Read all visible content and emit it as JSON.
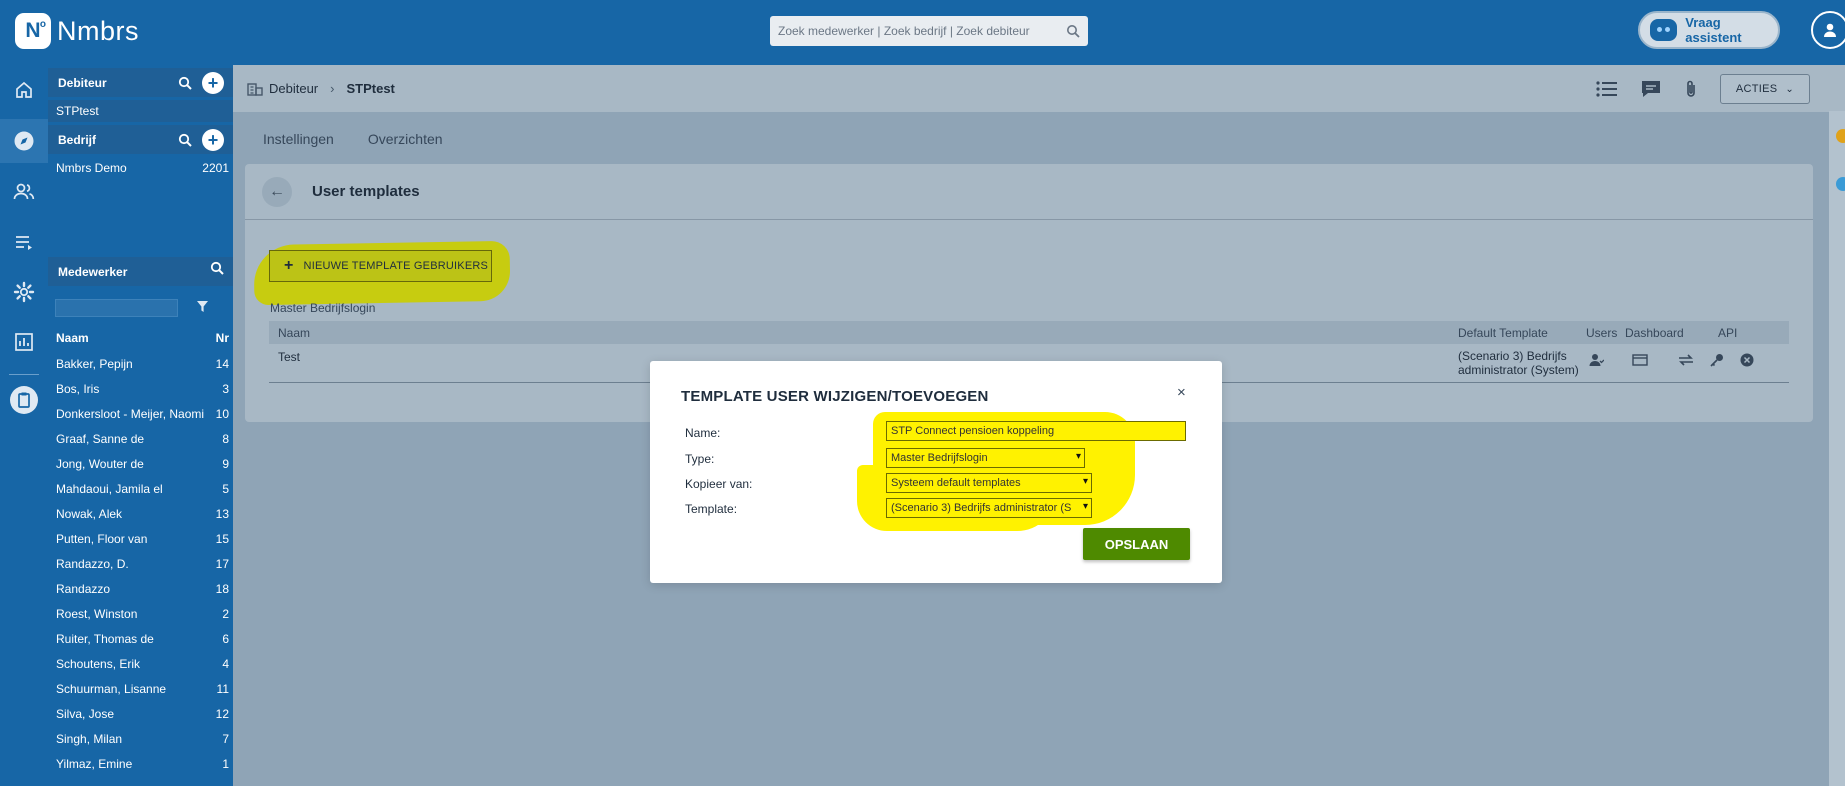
{
  "brand": {
    "name": "Nmbrs"
  },
  "top": {
    "search_placeholder": "Zoek medewerker | Zoek bedrijf | Zoek debiteur",
    "assistant_label": "Vraag assistent"
  },
  "sidebar": {
    "debiteur": {
      "header": "Debiteur",
      "items": [
        {
          "label": "STPtest"
        }
      ]
    },
    "bedrijf": {
      "header": "Bedrijf",
      "items": [
        {
          "label": "Nmbrs Demo",
          "num": "2201"
        }
      ]
    },
    "medewerker": {
      "header": "Medewerker",
      "columns": {
        "name": "Naam",
        "nr": "Nr"
      },
      "rows": [
        {
          "name": "Bakker, Pepijn",
          "nr": "14"
        },
        {
          "name": "Bos, Iris",
          "nr": "3"
        },
        {
          "name": "Donkersloot - Meijer, Naomi",
          "nr": "10"
        },
        {
          "name": "Graaf, Sanne de",
          "nr": "8"
        },
        {
          "name": "Jong, Wouter de",
          "nr": "9"
        },
        {
          "name": "Mahdaoui, Jamila el",
          "nr": "5"
        },
        {
          "name": "Nowak, Alek",
          "nr": "13"
        },
        {
          "name": "Putten, Floor van",
          "nr": "15"
        },
        {
          "name": "Randazzo, D.",
          "nr": "17"
        },
        {
          "name": "Randazzo",
          "nr": "18"
        },
        {
          "name": "Roest, Winston",
          "nr": "2"
        },
        {
          "name": "Ruiter, Thomas de",
          "nr": "6"
        },
        {
          "name": "Schoutens, Erik",
          "nr": "4"
        },
        {
          "name": "Schuurman, Lisanne",
          "nr": "11"
        },
        {
          "name": "Silva, Jose",
          "nr": "12"
        },
        {
          "name": "Singh, Milan",
          "nr": "7"
        },
        {
          "name": "Yilmaz, Emine",
          "nr": "1"
        }
      ]
    }
  },
  "breadcrumb": {
    "root": "Debiteur",
    "current": "STPtest"
  },
  "toolbar": {
    "acties": "ACTIES"
  },
  "tabs": [
    {
      "label": "Instellingen"
    },
    {
      "label": "Overzichten"
    }
  ],
  "page": {
    "title": "User templates",
    "new_button": "NIEUWE TEMPLATE GEBRUIKERS",
    "section_label": "Master Bedrijfslogin",
    "table": {
      "headers": {
        "naam": "Naam",
        "default_template": "Default Template",
        "users": "Users",
        "dashboard": "Dashboard",
        "api": "API"
      },
      "rows": [
        {
          "naam": "Test",
          "default_template": "(Scenario 3) Bedrijfs administrator (System)"
        }
      ]
    }
  },
  "modal": {
    "title": "TEMPLATE USER WIJZIGEN/TOEVOEGEN",
    "close": "×",
    "fields": {
      "name": {
        "label": "Name:",
        "value": "STP Connect pensioen koppeling"
      },
      "type": {
        "label": "Type:",
        "value": "Master Bedrijfslogin"
      },
      "kopieer": {
        "label": "Kopieer van:",
        "value": "Systeem default templates"
      },
      "template": {
        "label": "Template:",
        "value": "(Scenario 3) Bedrijfs administrator (S"
      }
    },
    "save_label": "OPSLAAN"
  },
  "colors": {
    "brand_blue": "#1766a6",
    "save_green": "#4e8a00",
    "highlight_yellow": "#fff200",
    "highlight_olive": "#c7cc10"
  },
  "icons": [
    "search-icon",
    "plus-icon",
    "home-icon",
    "compass-icon",
    "users-icon",
    "list-icon",
    "gear-icon",
    "chart-icon",
    "clipboard-icon",
    "filter-icon",
    "list-view-icon",
    "chat-icon",
    "paperclip-icon",
    "back-arrow-icon",
    "close-icon",
    "user-icon",
    "window-icon",
    "sync-icon",
    "api-key-icon",
    "delete-icon",
    "profile-icon",
    "bot-icon"
  ]
}
